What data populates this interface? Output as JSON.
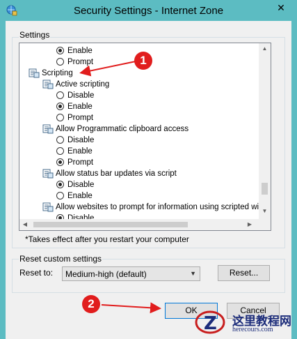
{
  "window": {
    "title": "Security Settings - Internet Zone",
    "close_glyph": "✕"
  },
  "settings_group": {
    "label": "Settings"
  },
  "tree_rows": [
    {
      "kind": "radio",
      "checked": true,
      "label": "Enable"
    },
    {
      "kind": "radio",
      "checked": false,
      "label": "Prompt"
    },
    {
      "kind": "category",
      "label": "Scripting"
    },
    {
      "kind": "setting",
      "label": "Active scripting"
    },
    {
      "kind": "radio",
      "checked": false,
      "label": "Disable"
    },
    {
      "kind": "radio",
      "checked": true,
      "label": "Enable"
    },
    {
      "kind": "radio",
      "checked": false,
      "label": "Prompt"
    },
    {
      "kind": "setting",
      "label": "Allow Programmatic clipboard access"
    },
    {
      "kind": "radio",
      "checked": false,
      "label": "Disable"
    },
    {
      "kind": "radio",
      "checked": false,
      "label": "Enable"
    },
    {
      "kind": "radio",
      "checked": true,
      "label": "Prompt"
    },
    {
      "kind": "setting",
      "label": "Allow status bar updates via script"
    },
    {
      "kind": "radio",
      "checked": true,
      "label": "Disable"
    },
    {
      "kind": "radio",
      "checked": false,
      "label": "Enable"
    },
    {
      "kind": "setting",
      "label": "Allow websites to prompt for information using scripted windo"
    },
    {
      "kind": "radio",
      "checked": true,
      "label": "Disable"
    }
  ],
  "note": "*Takes effect after you restart your computer",
  "reset_group": {
    "label": "Reset custom settings",
    "reset_to_label": "Reset to:",
    "selected": "Medium-high (default)",
    "reset_button": "Reset..."
  },
  "buttons": {
    "ok": "OK",
    "cancel": "Cancel"
  },
  "annotations": {
    "badge_1": "1",
    "badge_2": "2",
    "color": "#e11d1d"
  },
  "watermark": {
    "cn": "这里教程网",
    "url": "herecours.com"
  }
}
